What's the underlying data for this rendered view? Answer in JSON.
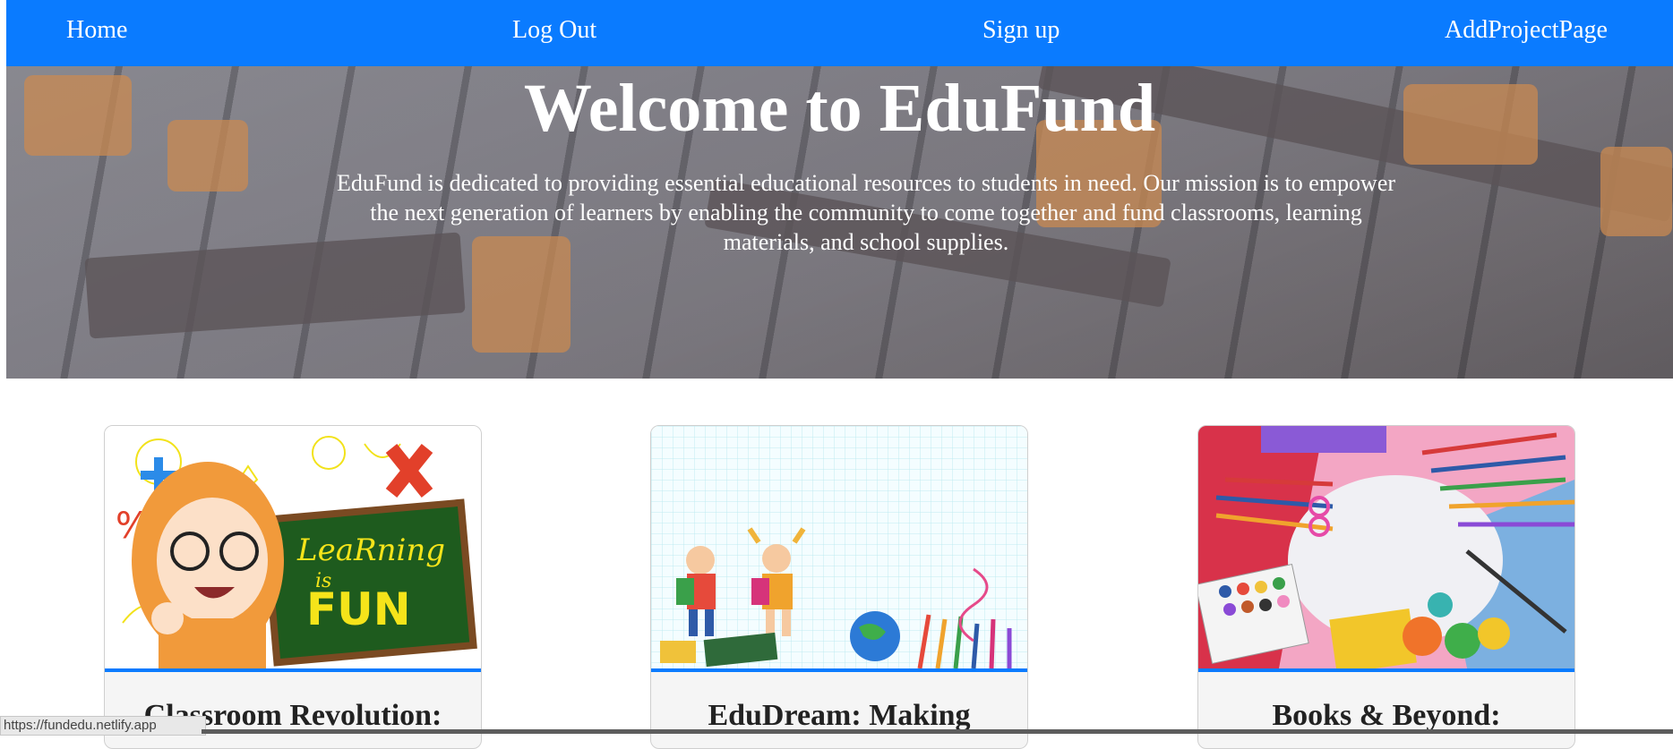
{
  "nav": {
    "home": "Home",
    "logout": "Log Out",
    "signup": "Sign up",
    "add_project": "AddProjectPage"
  },
  "hero": {
    "title": "Welcome to EduFund",
    "description": "EduFund is dedicated to providing essential educational resources to students in need. Our mission is to empower the next generation of learners by enabling the community to come together and fund classrooms, learning materials, and school supplies."
  },
  "cards": [
    {
      "title": "Classroom Revolution:",
      "image": "learning-is-fun-illustration",
      "image_text_1": "LeaRning",
      "image_text_2": "is",
      "image_text_3": "FUN"
    },
    {
      "title": "EduDream: Making",
      "image": "kids-with-backpacks-illustration"
    },
    {
      "title": "Books & Beyond:",
      "image": "art-supplies-photo"
    }
  ],
  "status_bar": {
    "url": "https://fundedu.netlify.app"
  },
  "colors": {
    "nav": "#0a7bff",
    "accent_bar": "#0a7bff"
  }
}
